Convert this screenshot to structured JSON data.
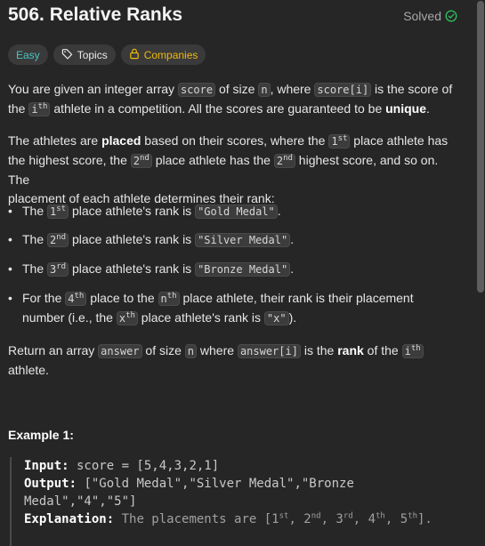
{
  "problem": {
    "title": "506. Relative Ranks",
    "solved_label": "Solved"
  },
  "tags": {
    "difficulty": "Easy",
    "topics": "Topics",
    "companies": "Companies"
  },
  "colors": {
    "easy": "#46c6c2",
    "companies": "#f0b90b",
    "solved_check": "#2cbb5d",
    "background": "#262626"
  },
  "description": {
    "p1": {
      "t1": "You are given an integer array ",
      "c1": "score",
      "t2": " of size ",
      "c2": "n",
      "t3": ", where ",
      "c3": "score[i]",
      "t4": " is the score of",
      "t5": "the ",
      "c4_base": "i",
      "c4_sup": "th",
      "t6": " athlete in a competition. All the scores are guaranteed to be ",
      "b1": "unique",
      "t7": "."
    },
    "p2": {
      "t1": "The athletes are ",
      "b1": "placed",
      "t2": " based on their scores, where the ",
      "c1_base": "1",
      "c1_sup": "st",
      "t3": " place athlete has",
      "t4": "the highest score, the ",
      "c2_base": "2",
      "c2_sup": "nd",
      "t5": " place athlete has the ",
      "c3_base": "2",
      "c3_sup": "nd",
      "t6": " highest score, and so on. The",
      "t7": "placement of each athlete determines their rank:"
    },
    "bullets": [
      {
        "t1": "The ",
        "c1_base": "1",
        "c1_sup": "st",
        "t2": " place athlete's rank is ",
        "c2": "\"Gold Medal\"",
        "t3": "."
      },
      {
        "t1": "The ",
        "c1_base": "2",
        "c1_sup": "nd",
        "t2": " place athlete's rank is ",
        "c2": "\"Silver Medal\"",
        "t3": "."
      },
      {
        "t1": "The ",
        "c1_base": "3",
        "c1_sup": "rd",
        "t2": " place athlete's rank is ",
        "c2": "\"Bronze Medal\"",
        "t3": "."
      },
      {
        "t1": "For the ",
        "c1_base": "4",
        "c1_sup": "th",
        "t2": " place to the ",
        "c2_base": "n",
        "c2_sup": "th",
        "t3": " place athlete, their rank is their placement",
        "t4": "number (i.e., the ",
        "c3_base": "x",
        "c3_sup": "th",
        "t5": " place athlete's rank is ",
        "c4": "\"x\"",
        "t6": ")."
      }
    ],
    "p3": {
      "t1": "Return an array ",
      "c1": "answer",
      "t2": " of size ",
      "c2": "n",
      "t3": " where ",
      "c3": "answer[i]",
      "t4": " is the ",
      "b1": "rank",
      "t5": " of the ",
      "c4_base": "i",
      "c4_sup": "th",
      "t6": "athlete."
    }
  },
  "example": {
    "heading": "Example 1:",
    "input_label": "Input:",
    "input_value": " score = [5,4,3,2,1]",
    "output_label": "Output:",
    "output_value_1": " [\"Gold Medal\",\"Silver Medal\",\"Bronze",
    "output_value_2": "Medal\",\"4\",\"5\"]",
    "explanation_label": "Explanation:",
    "explanation_text": " The placements are [1",
    "ranks": [
      {
        "base": "",
        "sup": "st"
      },
      {
        "base": ", 2",
        "sup": "nd"
      },
      {
        "base": ", 3",
        "sup": "rd"
      },
      {
        "base": ", 4",
        "sup": "th"
      },
      {
        "base": ", 5",
        "sup": "th"
      }
    ],
    "explanation_end": "]."
  }
}
